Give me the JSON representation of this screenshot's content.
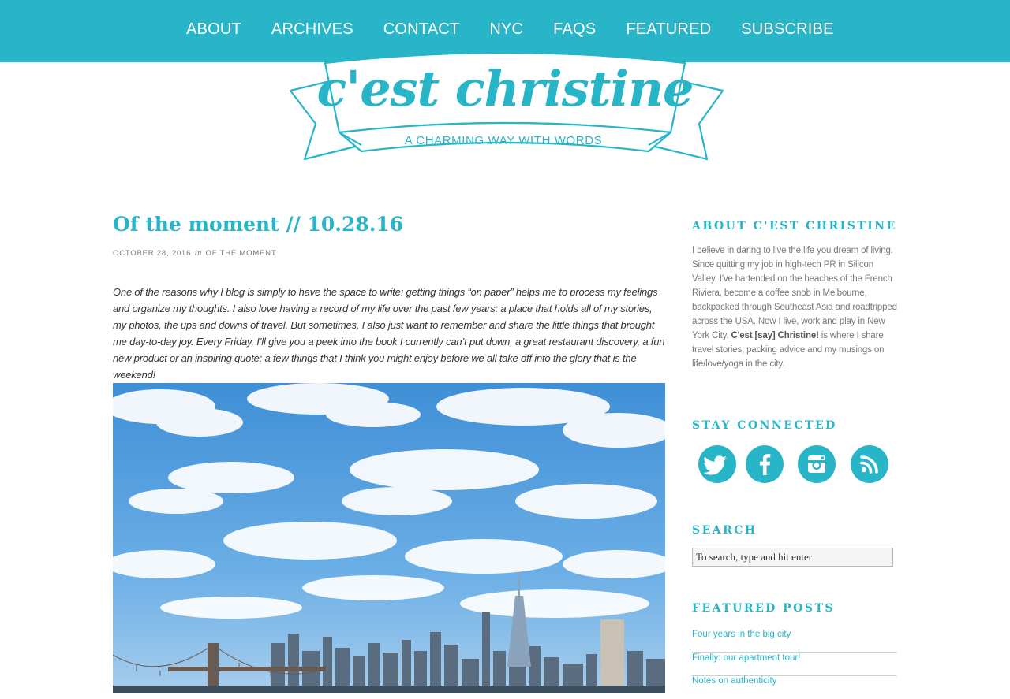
{
  "nav": {
    "items": [
      {
        "label": "ABOUT"
      },
      {
        "label": "ARCHIVES"
      },
      {
        "label": "CONTACT"
      },
      {
        "label": "NYC"
      },
      {
        "label": "FAQS"
      },
      {
        "label": "FEATURED"
      },
      {
        "label": "SUBSCRIBE"
      }
    ]
  },
  "brand": {
    "title": "c'est christine",
    "tagline": "A CHARMING WAY WITH WORDS",
    "color": "#28b5c8"
  },
  "post": {
    "title": "Of the moment // 10.28.16",
    "date": "OCTOBER 28, 2016",
    "in_word": "in",
    "category": "OF THE MOMENT",
    "body": "One of the reasons why I blog is simply to have the space to write: getting things “on paper” helps me to process my feelings and organize my thoughts. I also love having a record of my life over the past few years: a place that holds all of my stories, my photos, the ups and downs of travel. But sometimes, I also just want to remember and share the little things that brought me day-to-day joy. Every Friday, I’ll give you a peek into the book I currently can’t put down, a great restaurant discovery, a fun new product or an inspiring quote: a few things that I think you might enjoy before we all take off into the glory that is the weekend!"
  },
  "sidebar": {
    "about": {
      "heading": "ABOUT C'EST CHRISTINE",
      "text_before": "I believe in daring to live the life you dream of living. Since quitting my job in high-tech PR in Silicon Valley, I've bartended on the beaches of the French Riviera, become a coffee snob in Melbourne, backpacked through Southeast Asia and roadtripped across the USA. Now I live, work and play in New York City. ",
      "text_bold": "C'est [say] Christine!",
      "text_after": " is where I share travel stories, packing advice and my musings on life/love/yoga in the city."
    },
    "connect": {
      "heading": "STAY CONNECTED",
      "icons": [
        "twitter-icon",
        "facebook-icon",
        "instagram-icon",
        "rss-icon"
      ]
    },
    "search": {
      "heading": "SEARCH",
      "placeholder": "To search, type and hit enter"
    },
    "featured": {
      "heading": "FEATURED POSTS",
      "items": [
        {
          "label": "Four years in the big city"
        },
        {
          "label": "Finally: our apartment tour!"
        },
        {
          "label": "Notes on authenticity"
        }
      ]
    }
  }
}
